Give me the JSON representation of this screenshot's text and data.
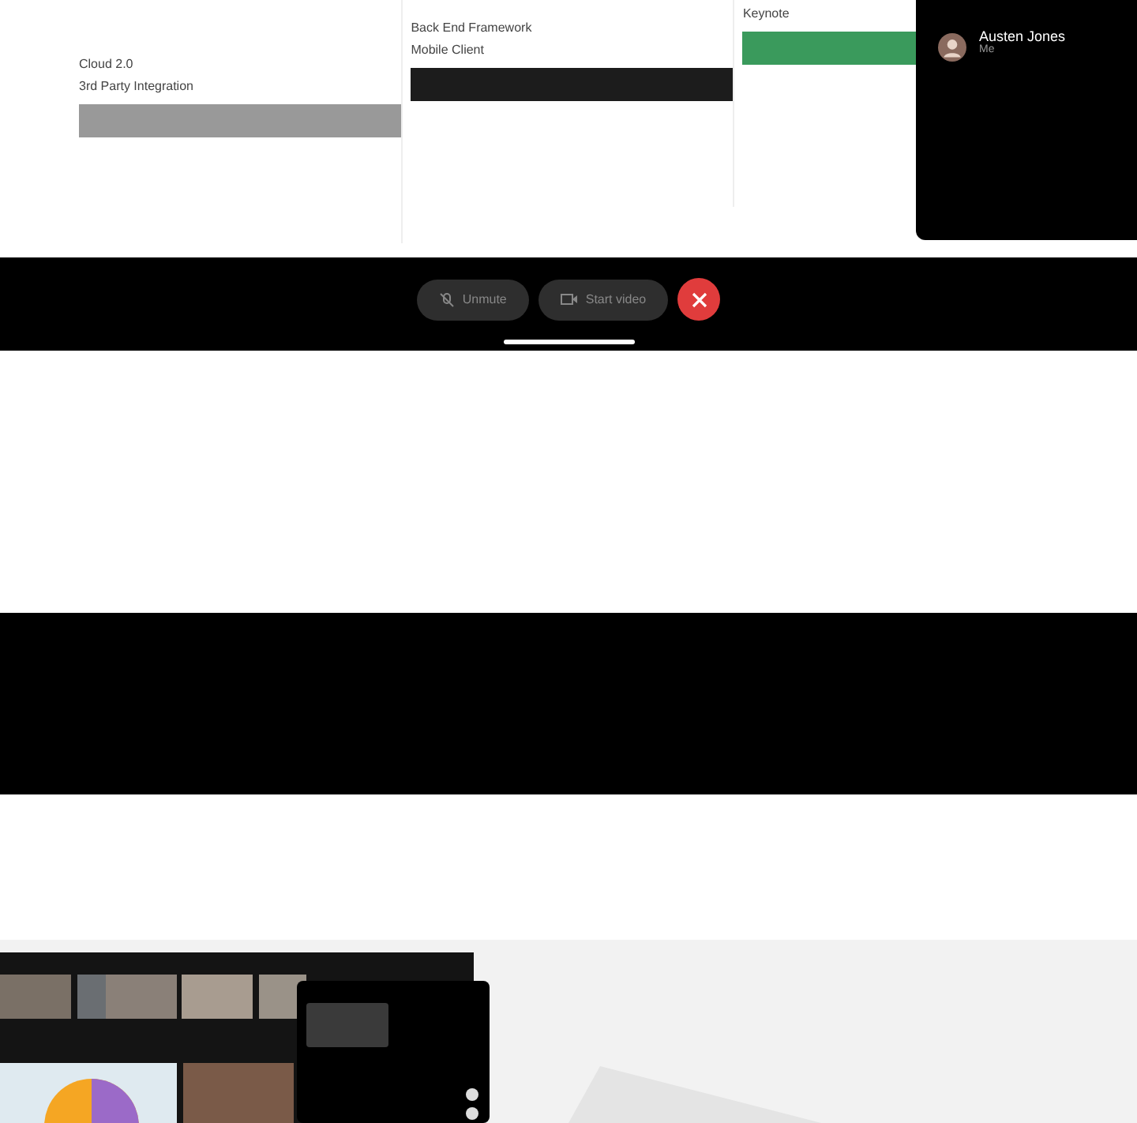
{
  "slide": {
    "columns": [
      {
        "lines": [
          "Cloud 2.0",
          "3rd Party Integration"
        ],
        "color": "#999999"
      },
      {
        "lines": [
          "Back End Framework",
          "Mobile Client"
        ],
        "color": "#1c1c1c"
      },
      {
        "lines": [
          "Keynote"
        ],
        "color": "#3a9a5c"
      }
    ]
  },
  "participant": {
    "name": "Austen Jones",
    "role": "Me"
  },
  "controls": [
    {
      "kind": "mute",
      "label": "Unmute"
    },
    {
      "kind": "video",
      "label": "Start video"
    },
    {
      "kind": "end"
    }
  ]
}
